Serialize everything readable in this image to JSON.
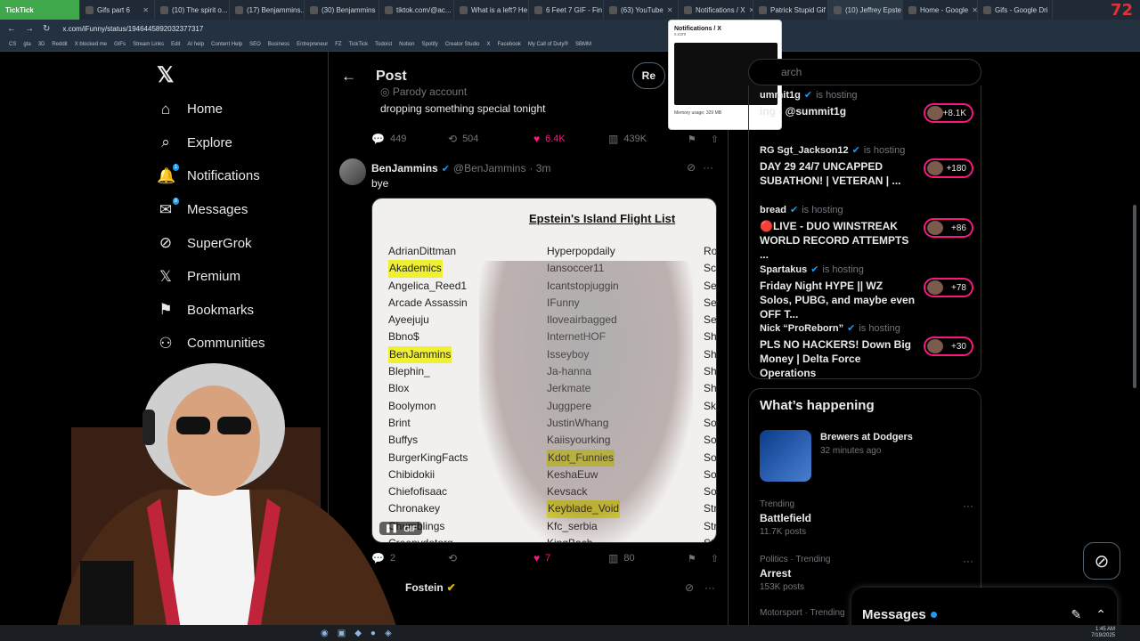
{
  "browser": {
    "first_tab_label": "TickTick",
    "tabs": [
      "Gifs part 6",
      "(10) The spirit o...",
      "(17) Benjammins...",
      "(30) Benjammins",
      "tiktok.com/@ac...",
      "What is a left? He",
      "6 Feet 7 GIF - Fin",
      "(63) YouTube",
      "Notifications / X",
      "Patrick Stupid Gif",
      "(10) Jeffrey Epste",
      "Home - Google",
      "Gifs - Google Dri"
    ],
    "counter": "72",
    "url": "x.com/iFunny/status/1946445892032377317",
    "bookmarks": [
      "CS",
      "gta",
      "3D",
      "Reddit",
      "X blocked me",
      "GIFs",
      "Stream Links",
      "Edit",
      "AI help",
      "Content Help",
      "SEO",
      "Business",
      "Entrepreneur",
      "FZ",
      "TickTick",
      "Todoist",
      "Notion",
      "Spotify",
      "Creator Studio",
      "X",
      "Facebook",
      "My Call of Duty®",
      "SBMM"
    ],
    "preview": {
      "title": "Notifications / X",
      "url": "x.com",
      "memory": "Memory usage: 329 MB"
    }
  },
  "nav": {
    "items": [
      {
        "label": "Home",
        "icon": "home-icon",
        "glyph": "⌂"
      },
      {
        "label": "Explore",
        "icon": "search-icon",
        "glyph": "⌕"
      },
      {
        "label": "Notifications",
        "icon": "bell-icon",
        "glyph": "🔔",
        "badge": "1"
      },
      {
        "label": "Messages",
        "icon": "mail-icon",
        "glyph": "✉",
        "badge": "8"
      },
      {
        "label": "SuperGrok",
        "icon": "grok-icon",
        "glyph": "⊘"
      },
      {
        "label": "Premium",
        "icon": "x-premium-icon",
        "glyph": "𝕏"
      },
      {
        "label": "Bookmarks",
        "icon": "bookmark-icon",
        "glyph": "⚑"
      },
      {
        "label": "Communities",
        "icon": "communities-icon",
        "glyph": "⚇"
      }
    ]
  },
  "post": {
    "header_title": "Post",
    "reply_label": "Re",
    "parody": "Parody account",
    "prev_text": "dropping something special tonight",
    "prev_stats": {
      "replies": "449",
      "reposts": "504",
      "likes": "6.4K",
      "views": "439K"
    },
    "tweet": {
      "name": "BenJammins",
      "handle": "@BenJammins",
      "time": "· 3m",
      "text": "bye",
      "gif_label": "GIF",
      "stats": {
        "replies": "2",
        "reposts": "",
        "likes": "7",
        "views": "80"
      }
    },
    "media": {
      "title": "Epstein's Island Flight List",
      "col1": [
        "AdrianDittman",
        "Akademics",
        "Angelica_Reed1",
        "Arcade Assassin",
        "Ayeejuju",
        "Bbno$",
        "BenJammins",
        "Blephin_",
        "Blox",
        "Boolymon",
        "Brint",
        "Buffys",
        "BurgerKingFacts",
        "Chibidokii",
        "Chiefofisaac",
        "Chronakey",
        "Chumblings",
        "Creepydotorg"
      ],
      "col2": [
        "Hyperpopdaily",
        "Iansoccer11",
        "Icantstopjuggin",
        "IFunny",
        "Iloveairbagged",
        "InternetHOF",
        "Isseyboy",
        "Ja-hanna",
        "Jerkmate",
        "Juggpere",
        "JustinWhang",
        "Kaiisyourking",
        "Kdot_Funnies",
        "KeshaEuw",
        "Kevsack",
        "Keyblade_Void",
        "Kfc_serbia",
        "KingBach"
      ],
      "col3": [
        "Ro",
        "Sch",
        "Se",
        "Se",
        "Se",
        "Sh",
        "Sh",
        "Sh",
        "Sh",
        "Sk",
        "So",
        "So",
        "So",
        "So",
        "So",
        "Str",
        "Str",
        "Str"
      ],
      "highlight_col1": [
        1,
        6
      ],
      "highlight_col2": [
        12,
        15
      ]
    },
    "next_tweet_name": "Fostein"
  },
  "right": {
    "search_placeholder": "arch",
    "lives": [
      {
        "host": "ummit1g",
        "title": "ing - @summit1g",
        "count": "+8.1K"
      },
      {
        "host": "RG Sgt_Jackson12",
        "title": "DAY 29 24/7 UNCAPPED SUBATHON! | VETERAN | ...",
        "count": "+180"
      },
      {
        "host": "bread",
        "title": "🔴LIVE - DUO WINSTREAK WORLD RECORD ATTEMPTS ...",
        "count": "+86"
      },
      {
        "host": "Spartakus",
        "title": "Friday Night HYPE || WZ Solos, PUBG, and maybe even OFF T...",
        "count": "+78"
      },
      {
        "host": "Nick “ProReborn”",
        "title": "PLS NO HACKERS! Down Big Money | Delta Force Operations",
        "count": "+30"
      }
    ],
    "is_hosting": "is hosting",
    "happening": {
      "title": "What’s happening",
      "event_title": "Brewers at Dodgers",
      "event_sub": "32 minutes ago",
      "trends": [
        {
          "context": "Trending",
          "name": "Battlefield",
          "posts": "11.7K posts"
        },
        {
          "context": "Politics · Trending",
          "name": "Arrest",
          "posts": "153K posts"
        },
        {
          "context": "Motorsport · Trending",
          "name": "",
          "posts": ""
        }
      ]
    },
    "messages_title": "Messages"
  },
  "taskbar": {
    "time": "1:45 AM",
    "date": "7/19/2025"
  },
  "colors": {
    "accent": "#1d9bf0",
    "like": "#f91880",
    "live_ring": "#f91880"
  }
}
